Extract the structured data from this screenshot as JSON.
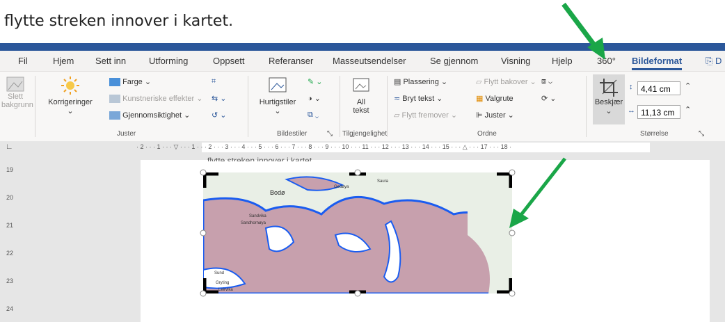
{
  "caption": "flytte streken innover i kartet.",
  "tabs": [
    "Fil",
    "Hjem",
    "Sett inn",
    "Utforming",
    "Oppsett",
    "Referanser",
    "Masseutsendelser",
    "Se gjennom",
    "Visning",
    "Hjelp",
    "360°",
    "Bildeformat"
  ],
  "active_tab": "Bildeformat",
  "share_label": "D",
  "ribbon": {
    "remove_bg": [
      "Slett",
      "bakgrunn"
    ],
    "corrections": "Korrigeringer",
    "color": "Farge",
    "artistic": "Kunstneriske effekter",
    "transparency": "Gjennomsiktighet",
    "group_adjust": "Juster",
    "quick_styles": "Hurtigstiler",
    "group_styles": "Bildestiler",
    "alt_text": [
      "All",
      "tekst"
    ],
    "group_access": "Tilgjengelighet",
    "position": "Plassering",
    "wrap": "Bryt tekst",
    "forward": "Flytt fremover",
    "backward": "Flytt bakover",
    "selection_pane": "Valgrute",
    "align": "Juster",
    "group_arrange": "Ordne",
    "crop": "Beskjær",
    "height": "4,41 cm",
    "width": "11,13 cm",
    "group_size": "Størrelse"
  },
  "ruler_numbers": "· 2 · · · 1 · · · ▽ · · · 1 · · · 2 · · · 3 · · · 4 · · · 5 · · · 6 · · · 7 · · · 8 · · · 9 · · · 10 · · · 11 · · · 12 · · · 13 · · · 14 · · · 15 · · · △ · · · 17 · · · 18 ·",
  "vruler_numbers": [
    "19",
    "20",
    "21",
    "22",
    "23",
    "24"
  ],
  "doc_text": "flytte streken innover i kartet.",
  "map_labels": [
    "Bodø",
    "Gedøya",
    "Saura",
    "Sandvika",
    "Sandhornøya",
    "Sund",
    "Gryting",
    "Leirvika"
  ],
  "colors": {
    "accent": "#2b579a",
    "arrow": "#1aa648",
    "map_land": "#c7a0ad",
    "map_water": "#ffffff",
    "map_border": "#1a5cf0",
    "map_bg": "#e9efe6"
  }
}
